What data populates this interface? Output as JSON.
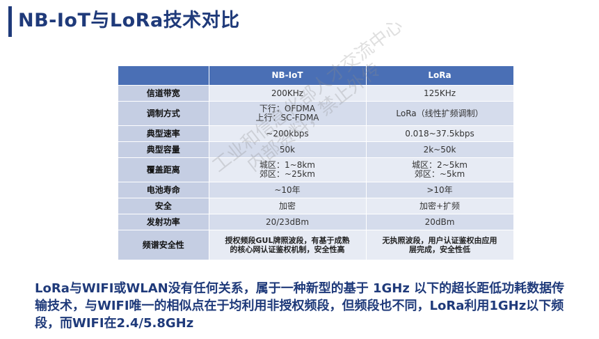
{
  "title": "NB-IoT与LoRa技术对比",
  "table": {
    "headers": [
      "",
      "NB-IoT",
      "LoRa"
    ],
    "rows": [
      {
        "label": "信道带宽",
        "nbiot": [
          "200KHz"
        ],
        "lora": [
          "125KHz"
        ],
        "bold": false
      },
      {
        "label": "调制方式",
        "nbiot": [
          "下行：OFDMA",
          "上行：SC-FDMA"
        ],
        "lora": [
          "LoRa（线性扩频调制）"
        ],
        "bold": false
      },
      {
        "label": "典型速率",
        "nbiot": [
          "~200kbps"
        ],
        "lora": [
          "0.018~37.5kbps"
        ],
        "bold": false
      },
      {
        "label": "典型容量",
        "nbiot": [
          "50k"
        ],
        "lora": [
          "2k~50k"
        ],
        "bold": false
      },
      {
        "label": "覆盖距离",
        "nbiot": [
          "城区：1~8km",
          "郊区：~25km"
        ],
        "lora": [
          "城区：2~5km",
          "郊区：~5km"
        ],
        "bold": false
      },
      {
        "label": "电池寿命",
        "nbiot": [
          "~10年"
        ],
        "lora": [
          ">10年"
        ],
        "bold": false
      },
      {
        "label": "安全",
        "nbiot": [
          "加密"
        ],
        "lora": [
          "加密+扩频"
        ],
        "bold": false
      },
      {
        "label": "发射功率",
        "nbiot": [
          "20/23dBm"
        ],
        "lora": [
          "20dBm"
        ],
        "bold": false
      },
      {
        "label": "频谱安全性",
        "nbiot": [
          "授权频段GUL牌照波段，有基于成熟",
          "的核心网认证鉴权机制，安全性高"
        ],
        "lora": [
          "无执照波段，用户认证鉴权由应用",
          "层完成，安全性低"
        ],
        "bold": true
      }
    ]
  },
  "summary": "LoRa与WIFI或WLAN没有任何关系，属于一种新型的基于 1GHz 以下的超长距低功耗数据传输技术，与WIFI唯一的相似点在于均利用非授权频段，但频段也不同，LoRa利用1GHz以下频段，而WIFI在2.4/5.8GHz",
  "watermark": [
    "工业和信息化部人才交流中心",
    "内部资料，禁止外传"
  ]
}
